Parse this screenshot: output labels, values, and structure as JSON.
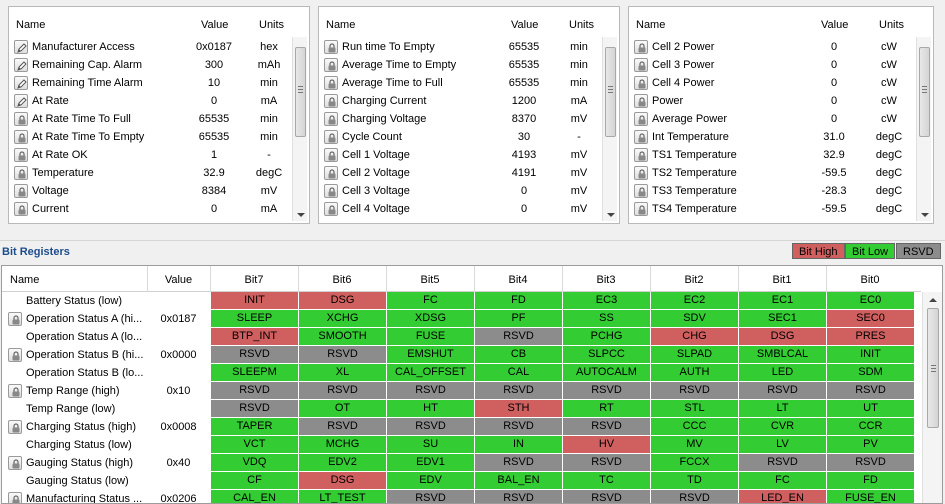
{
  "colors": {
    "high": "#d05f5f",
    "low": "#33cc33",
    "rsvd": "#8c8c8c"
  },
  "panels": [
    {
      "headers": {
        "name": "Name",
        "value": "Value",
        "units": "Units"
      },
      "rows": [
        {
          "name": "Manufacturer Access",
          "value": "0x0187",
          "units": "hex",
          "icon": "pencil-icon"
        },
        {
          "name": "Remaining Cap. Alarm",
          "value": "300",
          "units": "mAh",
          "icon": "pencil-icon"
        },
        {
          "name": "Remaining Time Alarm",
          "value": "10",
          "units": "min",
          "icon": "pencil-icon"
        },
        {
          "name": "At Rate",
          "value": "0",
          "units": "mA",
          "icon": "pencil-icon"
        },
        {
          "name": "At Rate Time To Full",
          "value": "65535",
          "units": "min",
          "icon": "lock-icon"
        },
        {
          "name": "At Rate Time To Empty",
          "value": "65535",
          "units": "min",
          "icon": "lock-icon"
        },
        {
          "name": "At Rate OK",
          "value": "1",
          "units": "-",
          "icon": "lock-icon"
        },
        {
          "name": "Temperature",
          "value": "32.9",
          "units": "degC",
          "icon": "lock-icon"
        },
        {
          "name": "Voltage",
          "value": "8384",
          "units": "mV",
          "icon": "lock-icon"
        },
        {
          "name": "Current",
          "value": "0",
          "units": "mA",
          "icon": "lock-icon"
        }
      ]
    },
    {
      "headers": {
        "name": "Name",
        "value": "Value",
        "units": "Units"
      },
      "rows": [
        {
          "name": "Run time To Empty",
          "value": "65535",
          "units": "min",
          "icon": "lock-icon"
        },
        {
          "name": "Average Time to Empty",
          "value": "65535",
          "units": "min",
          "icon": "lock-icon"
        },
        {
          "name": "Average Time to Full",
          "value": "65535",
          "units": "min",
          "icon": "lock-icon"
        },
        {
          "name": "Charging Current",
          "value": "1200",
          "units": "mA",
          "icon": "lock-icon"
        },
        {
          "name": "Charging Voltage",
          "value": "8370",
          "units": "mV",
          "icon": "lock-icon"
        },
        {
          "name": "Cycle Count",
          "value": "30",
          "units": "-",
          "icon": "lock-icon"
        },
        {
          "name": "Cell 1 Voltage",
          "value": "4193",
          "units": "mV",
          "icon": "lock-icon"
        },
        {
          "name": "Cell 2 Voltage",
          "value": "4191",
          "units": "mV",
          "icon": "lock-icon"
        },
        {
          "name": "Cell 3 Voltage",
          "value": "0",
          "units": "mV",
          "icon": "lock-icon"
        },
        {
          "name": "Cell 4 Voltage",
          "value": "0",
          "units": "mV",
          "icon": "lock-icon"
        }
      ]
    },
    {
      "headers": {
        "name": "Name",
        "value": "Value",
        "units": "Units"
      },
      "rows": [
        {
          "name": "Cell 2 Power",
          "value": "0",
          "units": "cW",
          "icon": "lock-icon"
        },
        {
          "name": "Cell 3 Power",
          "value": "0",
          "units": "cW",
          "icon": "lock-icon"
        },
        {
          "name": "Cell 4 Power",
          "value": "0",
          "units": "cW",
          "icon": "lock-icon"
        },
        {
          "name": "Power",
          "value": "0",
          "units": "cW",
          "icon": "lock-icon"
        },
        {
          "name": "Average Power",
          "value": "0",
          "units": "cW",
          "icon": "lock-icon"
        },
        {
          "name": "Int Temperature",
          "value": "31.0",
          "units": "degC",
          "icon": "lock-icon"
        },
        {
          "name": "TS1 Temperature",
          "value": "32.9",
          "units": "degC",
          "icon": "lock-icon"
        },
        {
          "name": "TS2 Temperature",
          "value": "-59.5",
          "units": "degC",
          "icon": "lock-icon"
        },
        {
          "name": "TS3 Temperature",
          "value": "-28.3",
          "units": "degC",
          "icon": "lock-icon"
        },
        {
          "name": "TS4 Temperature",
          "value": "-59.5",
          "units": "degC",
          "icon": "lock-icon"
        }
      ]
    }
  ],
  "bit_registers": {
    "title": "Bit Registers",
    "legend": {
      "high": "Bit High",
      "low": "Bit Low",
      "rsvd": "RSVD"
    },
    "headers": [
      "Name",
      "Value",
      "Bit7",
      "Bit6",
      "Bit5",
      "Bit4",
      "Bit3",
      "Bit2",
      "Bit1",
      "Bit0"
    ],
    "rows": [
      {
        "name": "Battery Status (low)",
        "value": "",
        "icon": false,
        "bits": [
          [
            "INIT",
            "h"
          ],
          [
            "DSG",
            "h"
          ],
          [
            "FC",
            "l"
          ],
          [
            "FD",
            "l"
          ],
          [
            "EC3",
            "l"
          ],
          [
            "EC2",
            "l"
          ],
          [
            "EC1",
            "l"
          ],
          [
            "EC0",
            "l"
          ]
        ]
      },
      {
        "name": "Operation Status A (hi...",
        "value": "0x0187",
        "icon": true,
        "bits": [
          [
            "SLEEP",
            "l"
          ],
          [
            "XCHG",
            "l"
          ],
          [
            "XDSG",
            "l"
          ],
          [
            "PF",
            "l"
          ],
          [
            "SS",
            "l"
          ],
          [
            "SDV",
            "l"
          ],
          [
            "SEC1",
            "l"
          ],
          [
            "SEC0",
            "h"
          ]
        ]
      },
      {
        "name": "Operation Status A (lo...",
        "value": "",
        "icon": false,
        "bits": [
          [
            "BTP_INT",
            "h"
          ],
          [
            "SMOOTH",
            "l"
          ],
          [
            "FUSE",
            "l"
          ],
          [
            "RSVD",
            "r"
          ],
          [
            "PCHG",
            "l"
          ],
          [
            "CHG",
            "h"
          ],
          [
            "DSG",
            "h"
          ],
          [
            "PRES",
            "h"
          ]
        ]
      },
      {
        "name": "Operation Status B (hi...",
        "value": "0x0000",
        "icon": true,
        "bits": [
          [
            "RSVD",
            "r"
          ],
          [
            "RSVD",
            "r"
          ],
          [
            "EMSHUT",
            "l"
          ],
          [
            "CB",
            "l"
          ],
          [
            "SLPCC",
            "l"
          ],
          [
            "SLPAD",
            "l"
          ],
          [
            "SMBLCAL",
            "l"
          ],
          [
            "INIT",
            "l"
          ]
        ]
      },
      {
        "name": "Operation Status B (lo...",
        "value": "",
        "icon": false,
        "bits": [
          [
            "SLEEPM",
            "l"
          ],
          [
            "XL",
            "l"
          ],
          [
            "CAL_OFFSET",
            "l"
          ],
          [
            "CAL",
            "l"
          ],
          [
            "AUTOCALM",
            "l"
          ],
          [
            "AUTH",
            "l"
          ],
          [
            "LED",
            "l"
          ],
          [
            "SDM",
            "l"
          ]
        ]
      },
      {
        "name": "Temp Range (high)",
        "value": "0x10",
        "icon": true,
        "bits": [
          [
            "RSVD",
            "r"
          ],
          [
            "RSVD",
            "r"
          ],
          [
            "RSVD",
            "r"
          ],
          [
            "RSVD",
            "r"
          ],
          [
            "RSVD",
            "r"
          ],
          [
            "RSVD",
            "r"
          ],
          [
            "RSVD",
            "r"
          ],
          [
            "RSVD",
            "r"
          ]
        ]
      },
      {
        "name": "Temp Range (low)",
        "value": "",
        "icon": false,
        "bits": [
          [
            "RSVD",
            "r"
          ],
          [
            "OT",
            "l"
          ],
          [
            "HT",
            "l"
          ],
          [
            "STH",
            "h"
          ],
          [
            "RT",
            "l"
          ],
          [
            "STL",
            "l"
          ],
          [
            "LT",
            "l"
          ],
          [
            "UT",
            "l"
          ]
        ]
      },
      {
        "name": "Charging Status (high)",
        "value": "0x0008",
        "icon": true,
        "bits": [
          [
            "TAPER",
            "l"
          ],
          [
            "RSVD",
            "r"
          ],
          [
            "RSVD",
            "r"
          ],
          [
            "RSVD",
            "r"
          ],
          [
            "RSVD",
            "r"
          ],
          [
            "CCC",
            "l"
          ],
          [
            "CVR",
            "l"
          ],
          [
            "CCR",
            "l"
          ]
        ]
      },
      {
        "name": "Charging Status (low)",
        "value": "",
        "icon": false,
        "bits": [
          [
            "VCT",
            "l"
          ],
          [
            "MCHG",
            "l"
          ],
          [
            "SU",
            "l"
          ],
          [
            "IN",
            "l"
          ],
          [
            "HV",
            "h"
          ],
          [
            "MV",
            "l"
          ],
          [
            "LV",
            "l"
          ],
          [
            "PV",
            "l"
          ]
        ]
      },
      {
        "name": "Gauging Status (high)",
        "value": "0x40",
        "icon": true,
        "bits": [
          [
            "VDQ",
            "l"
          ],
          [
            "EDV2",
            "l"
          ],
          [
            "EDV1",
            "l"
          ],
          [
            "RSVD",
            "r"
          ],
          [
            "RSVD",
            "r"
          ],
          [
            "FCCX",
            "l"
          ],
          [
            "RSVD",
            "r"
          ],
          [
            "RSVD",
            "r"
          ]
        ]
      },
      {
        "name": "Gauging Status (low)",
        "value": "",
        "icon": false,
        "bits": [
          [
            "CF",
            "l"
          ],
          [
            "DSG",
            "h"
          ],
          [
            "EDV",
            "l"
          ],
          [
            "BAL_EN",
            "l"
          ],
          [
            "TC",
            "l"
          ],
          [
            "TD",
            "l"
          ],
          [
            "FC",
            "l"
          ],
          [
            "FD",
            "l"
          ]
        ]
      },
      {
        "name": "Manufacturing Status ...",
        "value": "0x0206",
        "icon": true,
        "bits": [
          [
            "CAL_EN",
            "l"
          ],
          [
            "LT_TEST",
            "l"
          ],
          [
            "RSVD",
            "r"
          ],
          [
            "RSVD",
            "r"
          ],
          [
            "RSVD",
            "r"
          ],
          [
            "RSVD",
            "r"
          ],
          [
            "LED_EN",
            "h"
          ],
          [
            "FUSE_EN",
            "l"
          ]
        ]
      }
    ]
  }
}
